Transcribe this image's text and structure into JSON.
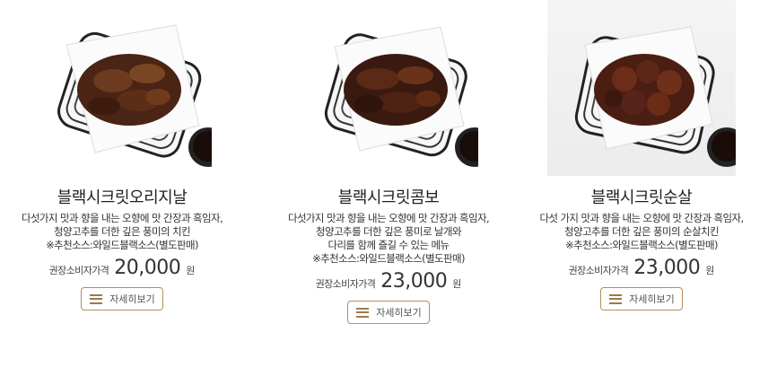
{
  "products": [
    {
      "name": "블랙시크릿오리지날",
      "description": [
        "다섯가지 맛과 향을 내는 오향에 맛 간장과 흑임자,",
        "청양고추를 더한 깊은 풍미의 치킨",
        "※추천소스:와일드블랙소스(별도판매)"
      ],
      "price_label": "권장소비자가격",
      "price": "20,000",
      "currency": "원",
      "button_label": "자세히보기",
      "image_alt": "black-secret-original-chicken-photo"
    },
    {
      "name": "블랙시크릿콤보",
      "description": [
        "다섯가지 맛과 향을 내는 오향에 맛 간장과 흑임자,",
        "청양고추를 더한 깊은 풍미로 날개와",
        "다리를 함께 즐길 수 있는 메뉴",
        "※추천소스:와일드블랙소스(별도판매)"
      ],
      "price_label": "권장소비자가격",
      "price": "23,000",
      "currency": "원",
      "button_label": "자세히보기",
      "image_alt": "black-secret-combo-chicken-photo"
    },
    {
      "name": "블랙시크릿순살",
      "description": [
        "다섯 가지 맛과 향을 내는 오향에 맛 간장과 흑임자,",
        "청양고추를 더한 깊은 풍미의 순살치킨",
        "※추천소스:와일드블랙소스(별도판매)"
      ],
      "price_label": "권장소비자가격",
      "price": "23,000",
      "currency": "원",
      "button_label": "자세히보기",
      "image_alt": "black-secret-boneless-chicken-photo"
    }
  ],
  "colors": {
    "button_border": "#b48f5c",
    "menu_icon": "#9a7a4e"
  },
  "icons": {
    "detail_button_icon": "hamburger-menu-icon"
  }
}
